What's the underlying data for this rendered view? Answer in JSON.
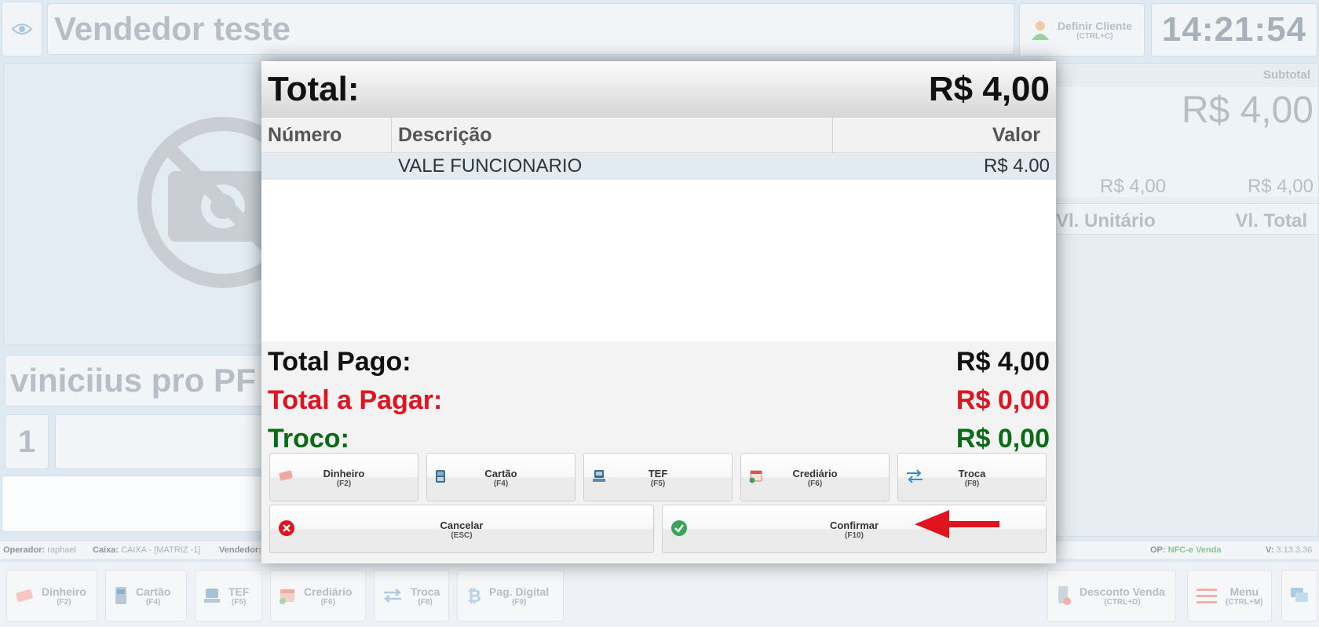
{
  "background": {
    "vendor_name": "Vendedor teste",
    "client_button": {
      "label": "Definir Cliente",
      "shortcut": "(CTRL+C)"
    },
    "clock": "14:21:54",
    "customer_name": "viniciius pro PF",
    "quantity": "1",
    "right_panel": {
      "subtotal_label": "Subtotal",
      "subtotal_value": "R$ 4,00",
      "col_unit": "Vl. Unitário",
      "col_total": "Vl. Total",
      "row_unit": "R$ 4,00",
      "row_total": "R$ 4,00"
    },
    "status": {
      "operator_label": "Operador:",
      "operator_value": "raphael",
      "cashier_label": "Caixa:",
      "cashier_value": "CAIXA - [MATRIZ -1]",
      "seller_label": "Vendedor:",
      "op_label": "OP:",
      "op_value": "NFC-e Venda",
      "version_label": "V:",
      "version_value": "3.13.3.36"
    },
    "function_bar": [
      {
        "label": "Dinheiro",
        "shortcut": "(F2)",
        "icon": "money-icon"
      },
      {
        "label": "Cartão",
        "shortcut": "(F4)",
        "icon": "card-terminal-icon"
      },
      {
        "label": "TEF",
        "shortcut": "(F5)",
        "icon": "tef-icon"
      },
      {
        "label": "Crediário",
        "shortcut": "(F6)",
        "icon": "calendar-icon"
      },
      {
        "label": "Troca",
        "shortcut": "(F8)",
        "icon": "exchange-icon"
      },
      {
        "label": "Pag. Digital",
        "shortcut": "(F9)",
        "icon": "bitcoin-icon"
      },
      {
        "label": "Desconto Venda",
        "shortcut": "(CTRL+D)",
        "icon": "phone-discount-icon"
      },
      {
        "label": "Menu",
        "shortcut": "(CTRL+M)",
        "icon": "hamburger-icon"
      }
    ]
  },
  "modal": {
    "title": "Total:",
    "total_value": "R$ 4,00",
    "columns": {
      "number": "Número",
      "description": "Descrição",
      "value": "Valor"
    },
    "rows": [
      {
        "number": "",
        "description": "VALE FUNCIONARIO",
        "value": "R$ 4.00"
      }
    ],
    "total_paid_label": "Total Pago:",
    "total_paid_value": "R$ 4,00",
    "to_pay_label": "Total a Pagar:",
    "to_pay_value": "R$ 0,00",
    "change_label": "Troco:",
    "change_value": "R$ 0,00",
    "payment_buttons": [
      {
        "label": "Dinheiro",
        "shortcut": "(F2)"
      },
      {
        "label": "Cartão",
        "shortcut": "(F4)"
      },
      {
        "label": "TEF",
        "shortcut": "(F5)"
      },
      {
        "label": "Crediário",
        "shortcut": "(F6)"
      },
      {
        "label": "Troca",
        "shortcut": "(F8)"
      }
    ],
    "cancel_button": {
      "label": "Cancelar",
      "shortcut": "(ESC)"
    },
    "confirm_button": {
      "label": "Confirmar",
      "shortcut": "(F10)"
    },
    "colors": {
      "to_pay": "#e0141e",
      "change": "#0a6b16",
      "arrow": "#e0141e"
    }
  }
}
